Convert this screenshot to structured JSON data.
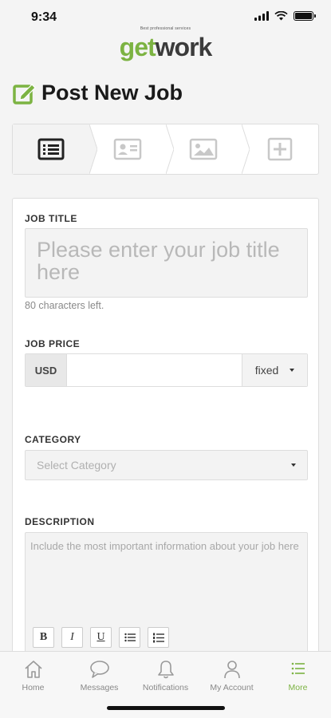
{
  "status": {
    "time": "9:34",
    "icons": [
      "signal-icon",
      "wifi-icon",
      "battery-icon"
    ]
  },
  "logo": {
    "part1": "get",
    "part2": "work",
    "tagline": "Best professional services"
  },
  "page": {
    "title": "Post New Job",
    "title_icon": "edit-icon"
  },
  "steps": [
    {
      "icon": "list-icon",
      "active": true
    },
    {
      "icon": "id-card-icon",
      "active": false
    },
    {
      "icon": "image-icon",
      "active": false
    },
    {
      "icon": "plus-square-icon",
      "active": false
    }
  ],
  "form": {
    "job_title": {
      "label": "JOB TITLE",
      "placeholder": "Please enter your job title here",
      "hint": "80 characters left."
    },
    "job_price": {
      "label": "JOB PRICE",
      "currency": "USD",
      "value": "",
      "type": "fixed"
    },
    "category": {
      "label": "CATEGORY",
      "placeholder": "Select Category"
    },
    "description": {
      "label": "DESCRIPTION",
      "placeholder": "Include the most important information about your job here",
      "toolbar": [
        "B",
        "I",
        "U",
        "bullet-list-icon",
        "numbered-list-icon"
      ]
    }
  },
  "tabbar": [
    {
      "label": "Home",
      "icon": "home-icon",
      "active": false
    },
    {
      "label": "Messages",
      "icon": "chat-bubble-icon",
      "active": false
    },
    {
      "label": "Notifications",
      "icon": "bell-icon",
      "active": false
    },
    {
      "label": "My Account",
      "icon": "user-icon",
      "active": false
    },
    {
      "label": "More",
      "icon": "menu-list-icon",
      "active": true
    }
  ],
  "colors": {
    "accent": "#7cb342",
    "inactive": "#888888",
    "field_bg": "#f3f3f3",
    "border": "#dddddd"
  }
}
